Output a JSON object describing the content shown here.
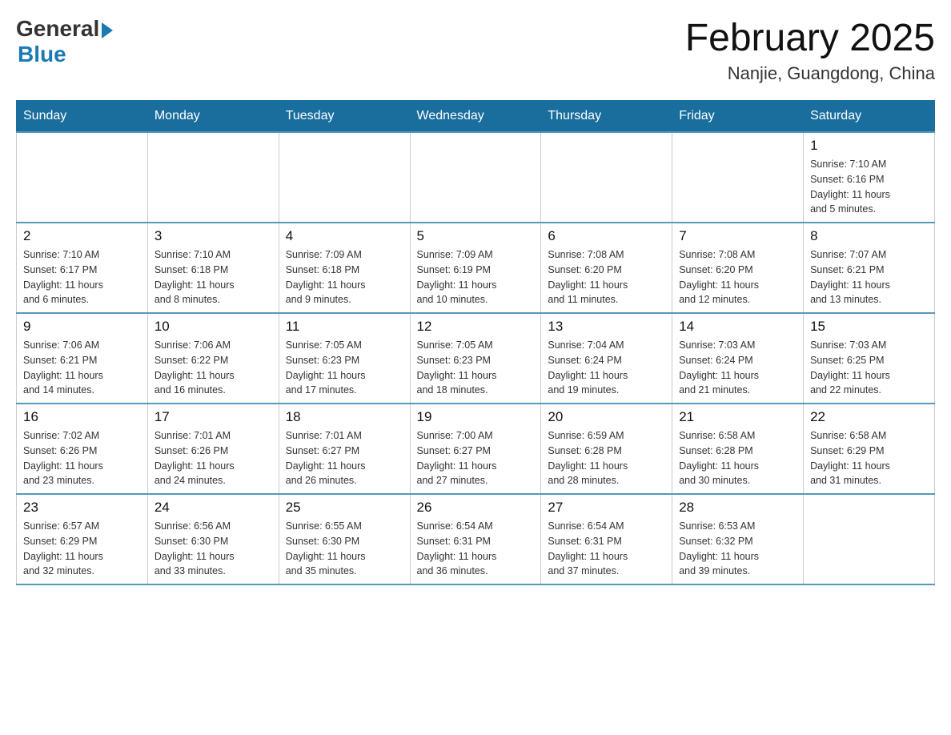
{
  "header": {
    "logo_general": "General",
    "logo_blue": "Blue",
    "month_title": "February 2025",
    "location": "Nanjie, Guangdong, China"
  },
  "weekdays": [
    "Sunday",
    "Monday",
    "Tuesday",
    "Wednesday",
    "Thursday",
    "Friday",
    "Saturday"
  ],
  "weeks": [
    [
      {
        "day": "",
        "info": ""
      },
      {
        "day": "",
        "info": ""
      },
      {
        "day": "",
        "info": ""
      },
      {
        "day": "",
        "info": ""
      },
      {
        "day": "",
        "info": ""
      },
      {
        "day": "",
        "info": ""
      },
      {
        "day": "1",
        "info": "Sunrise: 7:10 AM\nSunset: 6:16 PM\nDaylight: 11 hours\nand 5 minutes."
      }
    ],
    [
      {
        "day": "2",
        "info": "Sunrise: 7:10 AM\nSunset: 6:17 PM\nDaylight: 11 hours\nand 6 minutes."
      },
      {
        "day": "3",
        "info": "Sunrise: 7:10 AM\nSunset: 6:18 PM\nDaylight: 11 hours\nand 8 minutes."
      },
      {
        "day": "4",
        "info": "Sunrise: 7:09 AM\nSunset: 6:18 PM\nDaylight: 11 hours\nand 9 minutes."
      },
      {
        "day": "5",
        "info": "Sunrise: 7:09 AM\nSunset: 6:19 PM\nDaylight: 11 hours\nand 10 minutes."
      },
      {
        "day": "6",
        "info": "Sunrise: 7:08 AM\nSunset: 6:20 PM\nDaylight: 11 hours\nand 11 minutes."
      },
      {
        "day": "7",
        "info": "Sunrise: 7:08 AM\nSunset: 6:20 PM\nDaylight: 11 hours\nand 12 minutes."
      },
      {
        "day": "8",
        "info": "Sunrise: 7:07 AM\nSunset: 6:21 PM\nDaylight: 11 hours\nand 13 minutes."
      }
    ],
    [
      {
        "day": "9",
        "info": "Sunrise: 7:06 AM\nSunset: 6:21 PM\nDaylight: 11 hours\nand 14 minutes."
      },
      {
        "day": "10",
        "info": "Sunrise: 7:06 AM\nSunset: 6:22 PM\nDaylight: 11 hours\nand 16 minutes."
      },
      {
        "day": "11",
        "info": "Sunrise: 7:05 AM\nSunset: 6:23 PM\nDaylight: 11 hours\nand 17 minutes."
      },
      {
        "day": "12",
        "info": "Sunrise: 7:05 AM\nSunset: 6:23 PM\nDaylight: 11 hours\nand 18 minutes."
      },
      {
        "day": "13",
        "info": "Sunrise: 7:04 AM\nSunset: 6:24 PM\nDaylight: 11 hours\nand 19 minutes."
      },
      {
        "day": "14",
        "info": "Sunrise: 7:03 AM\nSunset: 6:24 PM\nDaylight: 11 hours\nand 21 minutes."
      },
      {
        "day": "15",
        "info": "Sunrise: 7:03 AM\nSunset: 6:25 PM\nDaylight: 11 hours\nand 22 minutes."
      }
    ],
    [
      {
        "day": "16",
        "info": "Sunrise: 7:02 AM\nSunset: 6:26 PM\nDaylight: 11 hours\nand 23 minutes."
      },
      {
        "day": "17",
        "info": "Sunrise: 7:01 AM\nSunset: 6:26 PM\nDaylight: 11 hours\nand 24 minutes."
      },
      {
        "day": "18",
        "info": "Sunrise: 7:01 AM\nSunset: 6:27 PM\nDaylight: 11 hours\nand 26 minutes."
      },
      {
        "day": "19",
        "info": "Sunrise: 7:00 AM\nSunset: 6:27 PM\nDaylight: 11 hours\nand 27 minutes."
      },
      {
        "day": "20",
        "info": "Sunrise: 6:59 AM\nSunset: 6:28 PM\nDaylight: 11 hours\nand 28 minutes."
      },
      {
        "day": "21",
        "info": "Sunrise: 6:58 AM\nSunset: 6:28 PM\nDaylight: 11 hours\nand 30 minutes."
      },
      {
        "day": "22",
        "info": "Sunrise: 6:58 AM\nSunset: 6:29 PM\nDaylight: 11 hours\nand 31 minutes."
      }
    ],
    [
      {
        "day": "23",
        "info": "Sunrise: 6:57 AM\nSunset: 6:29 PM\nDaylight: 11 hours\nand 32 minutes."
      },
      {
        "day": "24",
        "info": "Sunrise: 6:56 AM\nSunset: 6:30 PM\nDaylight: 11 hours\nand 33 minutes."
      },
      {
        "day": "25",
        "info": "Sunrise: 6:55 AM\nSunset: 6:30 PM\nDaylight: 11 hours\nand 35 minutes."
      },
      {
        "day": "26",
        "info": "Sunrise: 6:54 AM\nSunset: 6:31 PM\nDaylight: 11 hours\nand 36 minutes."
      },
      {
        "day": "27",
        "info": "Sunrise: 6:54 AM\nSunset: 6:31 PM\nDaylight: 11 hours\nand 37 minutes."
      },
      {
        "day": "28",
        "info": "Sunrise: 6:53 AM\nSunset: 6:32 PM\nDaylight: 11 hours\nand 39 minutes."
      },
      {
        "day": "",
        "info": ""
      }
    ]
  ]
}
